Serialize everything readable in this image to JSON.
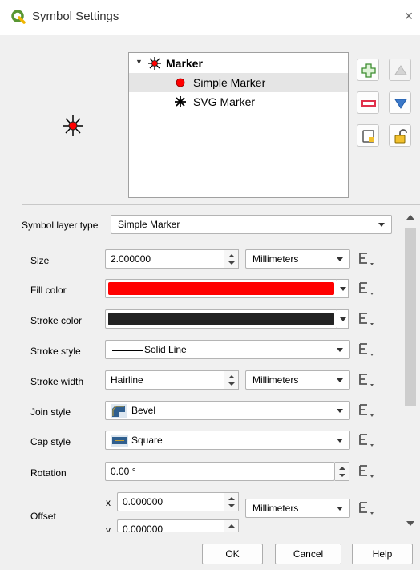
{
  "window": {
    "title": "Symbol Settings",
    "close_glyph": "×",
    "app_icon": "qgis-icon"
  },
  "symbol_tree": {
    "expander_glyph": "▼",
    "items": [
      {
        "label": "Marker",
        "icon": "marker-star-icon",
        "bold": true
      },
      {
        "label": "Simple Marker",
        "icon": "red-dot-icon",
        "selected": true
      },
      {
        "label": "SVG Marker",
        "icon": "svg-star-icon"
      }
    ]
  },
  "side_buttons": [
    "add-layer-icon",
    "move-up-icon",
    "remove-layer-icon",
    "move-down-icon",
    "duplicate-layer-icon",
    "lock-icon"
  ],
  "layer_type": {
    "label": "Symbol layer type",
    "value": "Simple Marker"
  },
  "props": {
    "size": {
      "label": "Size",
      "value": "2.000000",
      "unit": "Millimeters"
    },
    "fill_color": {
      "label": "Fill color",
      "color": "#ff0000"
    },
    "stroke_color": {
      "label": "Stroke color",
      "color": "#232323"
    },
    "stroke_style": {
      "label": "Stroke style",
      "value": "Solid Line"
    },
    "stroke_width": {
      "label": "Stroke width",
      "value": "Hairline",
      "unit": "Millimeters"
    },
    "join_style": {
      "label": "Join style",
      "value": "Bevel"
    },
    "cap_style": {
      "label": "Cap style",
      "value": "Square"
    },
    "rotation": {
      "label": "Rotation",
      "value": "0.00 °"
    },
    "offset": {
      "label": "Offset",
      "x_label": "x",
      "x_value": "0.000000",
      "y_label": "y",
      "y_value": "0.000000",
      "unit": "Millimeters"
    }
  },
  "buttons": {
    "ok": "OK",
    "cancel": "Cancel",
    "help": "Help"
  },
  "colors": {
    "accent_green": "#589632",
    "red": "#ff0000",
    "blue": "#1e5aa8"
  }
}
